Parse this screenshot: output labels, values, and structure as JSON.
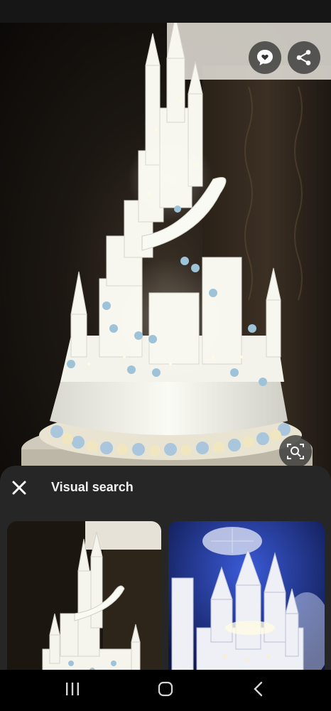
{
  "visual_search": {
    "title": "Visual search"
  },
  "icons": {
    "heart_comment": "heart-comment-icon",
    "share": "share-icon",
    "lens_search": "lens-search-icon",
    "close": "close-icon",
    "recents": "recents-icon",
    "home": "home-icon",
    "back": "back-icon"
  },
  "colors": {
    "sheet_bg": "#262626",
    "status_bar": "#161616",
    "nav_bar": "#000000"
  }
}
